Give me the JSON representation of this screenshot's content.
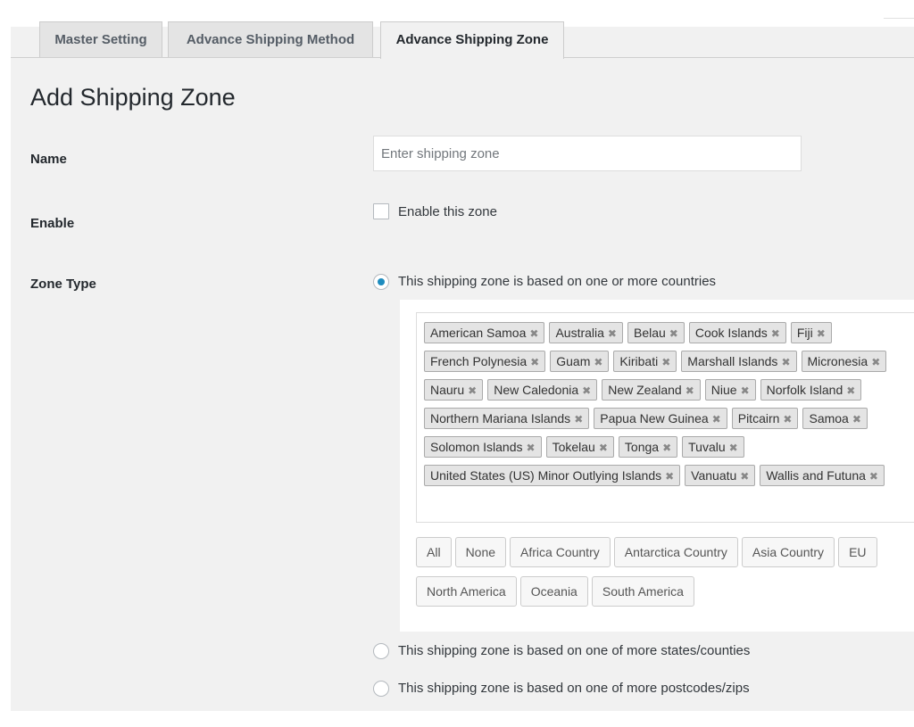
{
  "tabs": [
    {
      "label": "Master Setting"
    },
    {
      "label": "Advance Shipping Method"
    },
    {
      "label": "Advance Shipping Zone",
      "active": true
    }
  ],
  "page_title": "Add Shipping Zone",
  "form": {
    "name": {
      "label": "Name",
      "placeholder": "Enter shipping zone",
      "value": ""
    },
    "enable": {
      "label": "Enable",
      "checkbox_label": "Enable this zone",
      "checked": false
    },
    "zone_type": {
      "label": "Zone Type",
      "options": [
        {
          "label": "This shipping zone is based on one or more countries",
          "selected": true
        },
        {
          "label": "This shipping zone is based on one of more states/counties",
          "selected": false
        },
        {
          "label": "This shipping zone is based on one of more postcodes/zips",
          "selected": false
        }
      ]
    }
  },
  "countries": {
    "rows": [
      [
        "American Samoa",
        "Australia",
        "Belau",
        "Cook Islands",
        "Fiji"
      ],
      [
        "French Polynesia",
        "Guam",
        "Kiribati",
        "Marshall Islands",
        "Micronesia"
      ],
      [
        "Nauru",
        "New Caledonia",
        "New Zealand",
        "Niue",
        "Norfolk Island"
      ],
      [
        "Northern Mariana Islands",
        "Papua New Guinea",
        "Pitcairn",
        "Samoa"
      ],
      [
        "Solomon Islands",
        "Tokelau",
        "Tonga",
        "Tuvalu"
      ],
      [
        "United States (US) Minor Outlying Islands",
        "Vanuatu",
        "Wallis and Futuna"
      ]
    ],
    "remove_symbol": "✖"
  },
  "region_buttons": {
    "rows": [
      [
        "All",
        "None",
        "Africa Country",
        "Antarctica Country",
        "Asia Country",
        "EU"
      ],
      [
        "North America",
        "Oceania",
        "South America"
      ]
    ]
  }
}
